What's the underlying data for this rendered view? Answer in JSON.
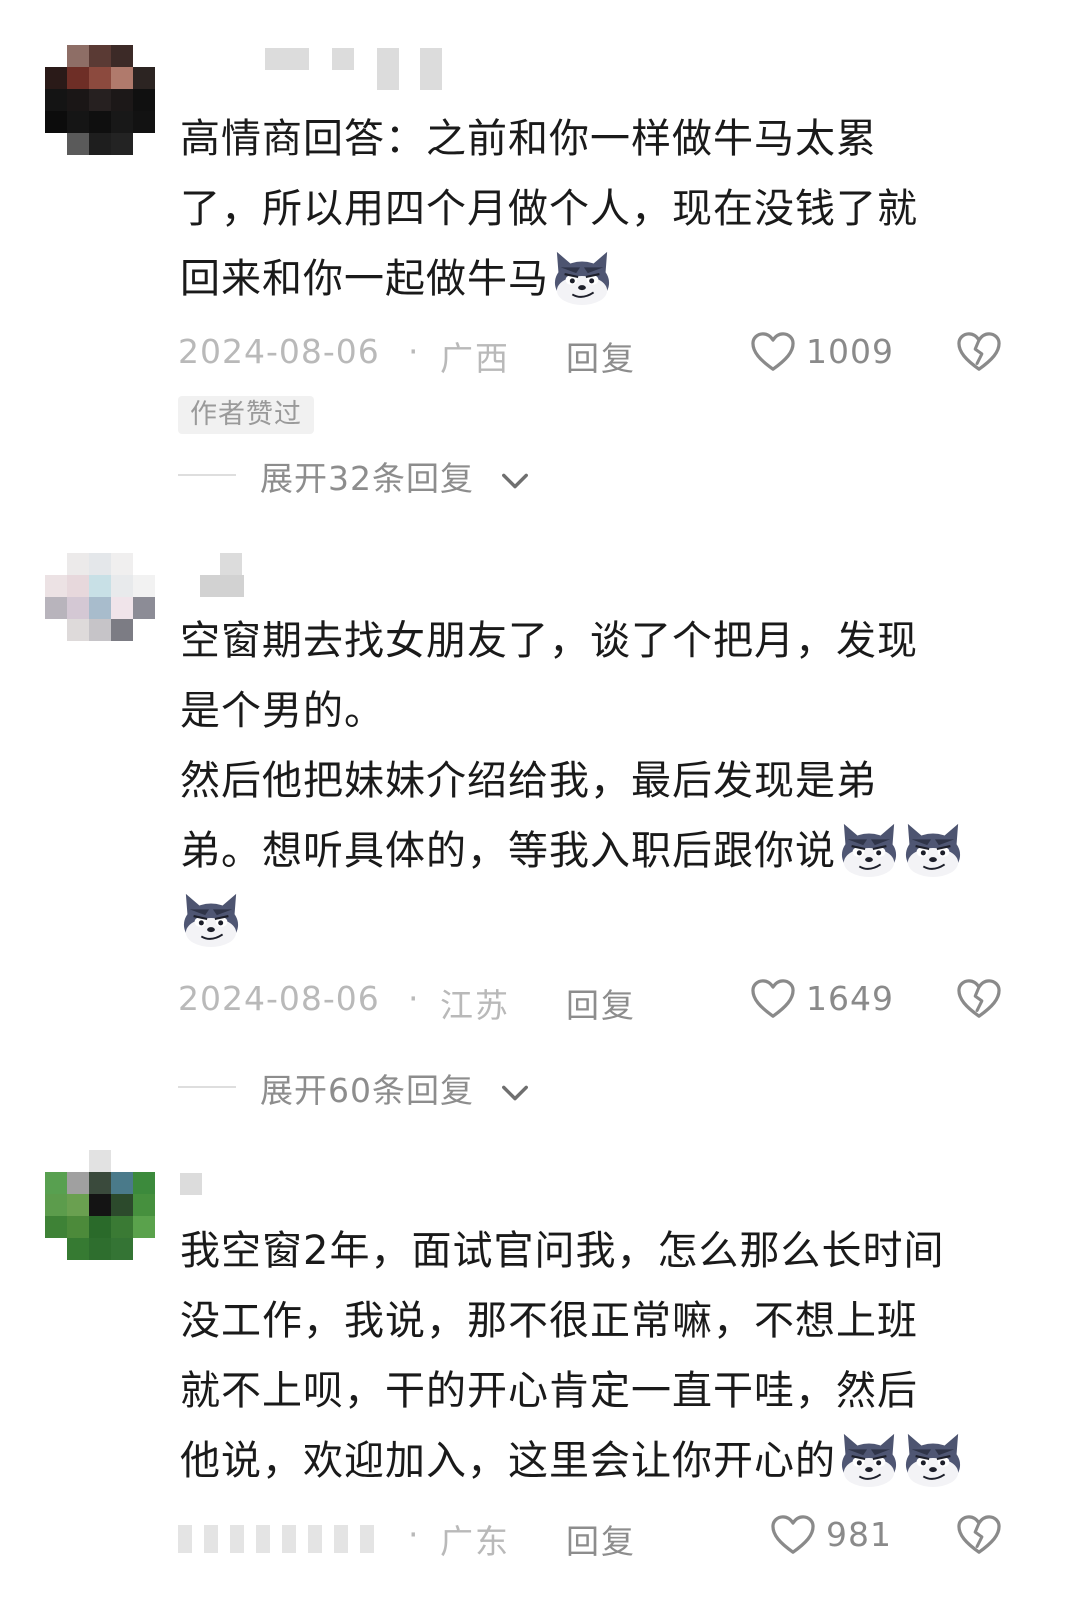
{
  "comments": [
    {
      "content_lines": [
        "高情商回答：之前和你一样做牛马太累",
        "了，所以用四个月做个人，现在没钱了就",
        "回来和你一起做牛马"
      ],
      "emoji_count": 1,
      "emoji_icon": "wolf-face-emoji-icon",
      "date": "2024-08-06",
      "separator": "·",
      "region": "广西",
      "reply_label": "回复",
      "like_count": "1009",
      "badge": "作者赞过",
      "expand_label": "展开32条回复"
    },
    {
      "content_lines": [
        "空窗期去找女朋友了，谈了个把月，发现",
        "是个男的。",
        "然后他把妹妹介绍给我，最后发现是弟",
        "弟。想听具体的，等我入职后跟你说"
      ],
      "emoji_count": 3,
      "emoji_icon": "wolf-face-emoji-icon",
      "date": "2024-08-06",
      "separator": "·",
      "region": "江苏",
      "reply_label": "回复",
      "like_count": "1649",
      "expand_label": "展开60条回复"
    },
    {
      "content_lines": [
        "我空窗2年，面试官问我，怎么那么长时间",
        "没工作，我说，那不很正常嘛，不想上班",
        "就不上呗，干的开心肯定一直干哇，然后",
        "他说，欢迎加入，这里会让你开心的"
      ],
      "emoji_count": 2,
      "emoji_icon": "wolf-face-emoji-icon",
      "separator": "·",
      "region": "广东",
      "reply_label": "回复",
      "like_count": "981"
    }
  ],
  "icons": {
    "like": "heart-outline-icon",
    "dislike": "broken-heart-icon",
    "expand": "chevron-down-icon"
  },
  "colors": {
    "text": "#1a1a1a",
    "meta": "#b9b9b9",
    "action": "#8d8d8d",
    "background": "#ffffff"
  }
}
